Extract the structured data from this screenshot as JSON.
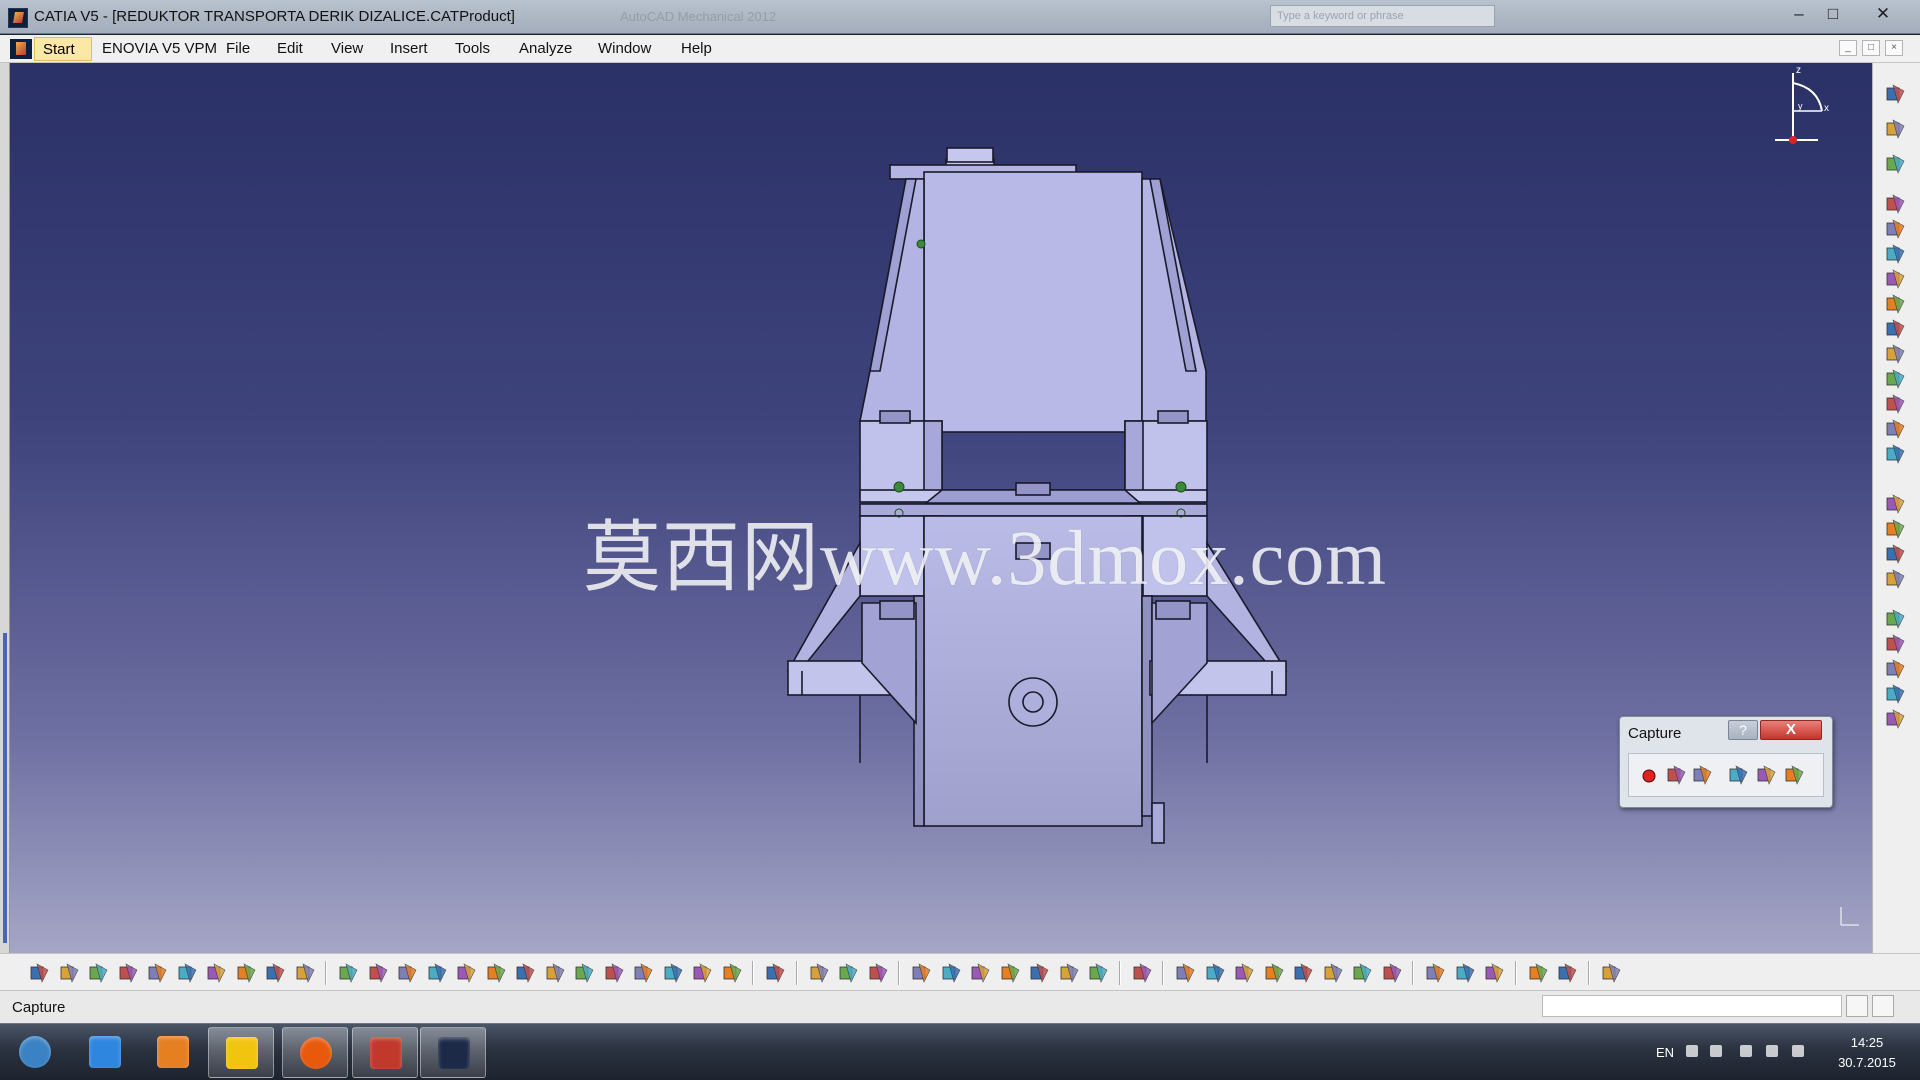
{
  "window": {
    "title": "CATIA V5 - [REDUKTOR TRANSPORTA DERIK DIZALICE.CATProduct]",
    "background_title": "AutoCAD Mechanical 2012",
    "search_placeholder": "Type a keyword or phrase",
    "minimize_label": "–",
    "maximize_label": "□",
    "close_label": "✕"
  },
  "menubar": {
    "start": "Start",
    "items": [
      "ENOVIA V5 VPM",
      "File",
      "Edit",
      "View",
      "Insert",
      "Tools",
      "Analyze",
      "Window",
      "Help"
    ],
    "mdi_buttons": [
      "_",
      "□",
      "×"
    ]
  },
  "viewport": {
    "watermark": "莫西网www.3dmox.com",
    "compass_labels": {
      "z": "z",
      "x": "x",
      "y": "y"
    },
    "colors": {
      "bg_top": "#2a3166",
      "bg_bottom": "#a5a6c6",
      "part": "#b3b4e3",
      "edge": "#1a1a2a"
    }
  },
  "right_toolbar": {
    "icons": [
      "sketcher-icon",
      "select-icon",
      "compass-icon",
      "new-component-icon",
      "new-product-icon",
      "new-part-icon",
      "existing-component-icon",
      "replace-component-icon",
      "graph-tree-icon",
      "generate-numbering-icon",
      "selective-load-icon",
      "manage-representations-icon",
      "fast-multi-instantiation-icon",
      "manipulation-icon",
      "snap-icon",
      "explode-icon",
      "stop-manipulate-icon",
      "constraint-coincidence-icon",
      "constraint-contact-icon",
      "constraint-offset-icon",
      "constraint-angle-icon",
      "fix-component-icon",
      "update-icon"
    ]
  },
  "bottom_toolbar": {
    "icons": [
      "new-icon",
      "open-icon",
      "save-icon",
      "print-icon",
      "cut-icon",
      "copy-icon",
      "paste-icon",
      "undo-icon",
      "redo-icon",
      "whats-this-icon",
      "fly-mode-icon",
      "fit-all-icon",
      "pan-icon",
      "rotate-icon",
      "zoom-in-icon",
      "zoom-out-icon",
      "normal-view-icon",
      "multi-view-icon",
      "iso-view-icon",
      "shading-icon",
      "hide-show-icon",
      "swap-space-icon",
      "catalog-icon",
      "tolerance-icon",
      "measure-icon",
      "formula-icon",
      "annotation-icon",
      "knowledge-icon",
      "table-icon",
      "tree-icon",
      "clash-icon",
      "sectioning-icon",
      "distance-icon",
      "mass-icon",
      "weight-icon",
      "refresh-icon",
      "assembly-feature-icon",
      "part-design-icon",
      "split-icon",
      "hole-icon",
      "pocket-icon",
      "remove-icon",
      "bom-icon",
      "publication-icon",
      "update-all-icon",
      "scenes-icon",
      "analysis-icon",
      "render-icon",
      "apply-material-icon",
      "catia-logo-icon"
    ]
  },
  "statusbar": {
    "message": "Capture"
  },
  "capture_dialog": {
    "title": "Capture",
    "help_label": "?",
    "close_label": "X",
    "buttons": [
      "record-icon",
      "select-mode-icon",
      "options-icon",
      "capture-icon",
      "album-icon",
      "image-editor-icon"
    ]
  },
  "taskbar": {
    "apps": [
      "windows-start-icon",
      "internet-explorer-icon",
      "media-player-icon",
      "file-explorer-icon",
      "firefox-icon",
      "autocad-mechanical-icon",
      "catia-icon"
    ],
    "language": "EN",
    "time": "14:25",
    "date": "30.7.2015"
  }
}
